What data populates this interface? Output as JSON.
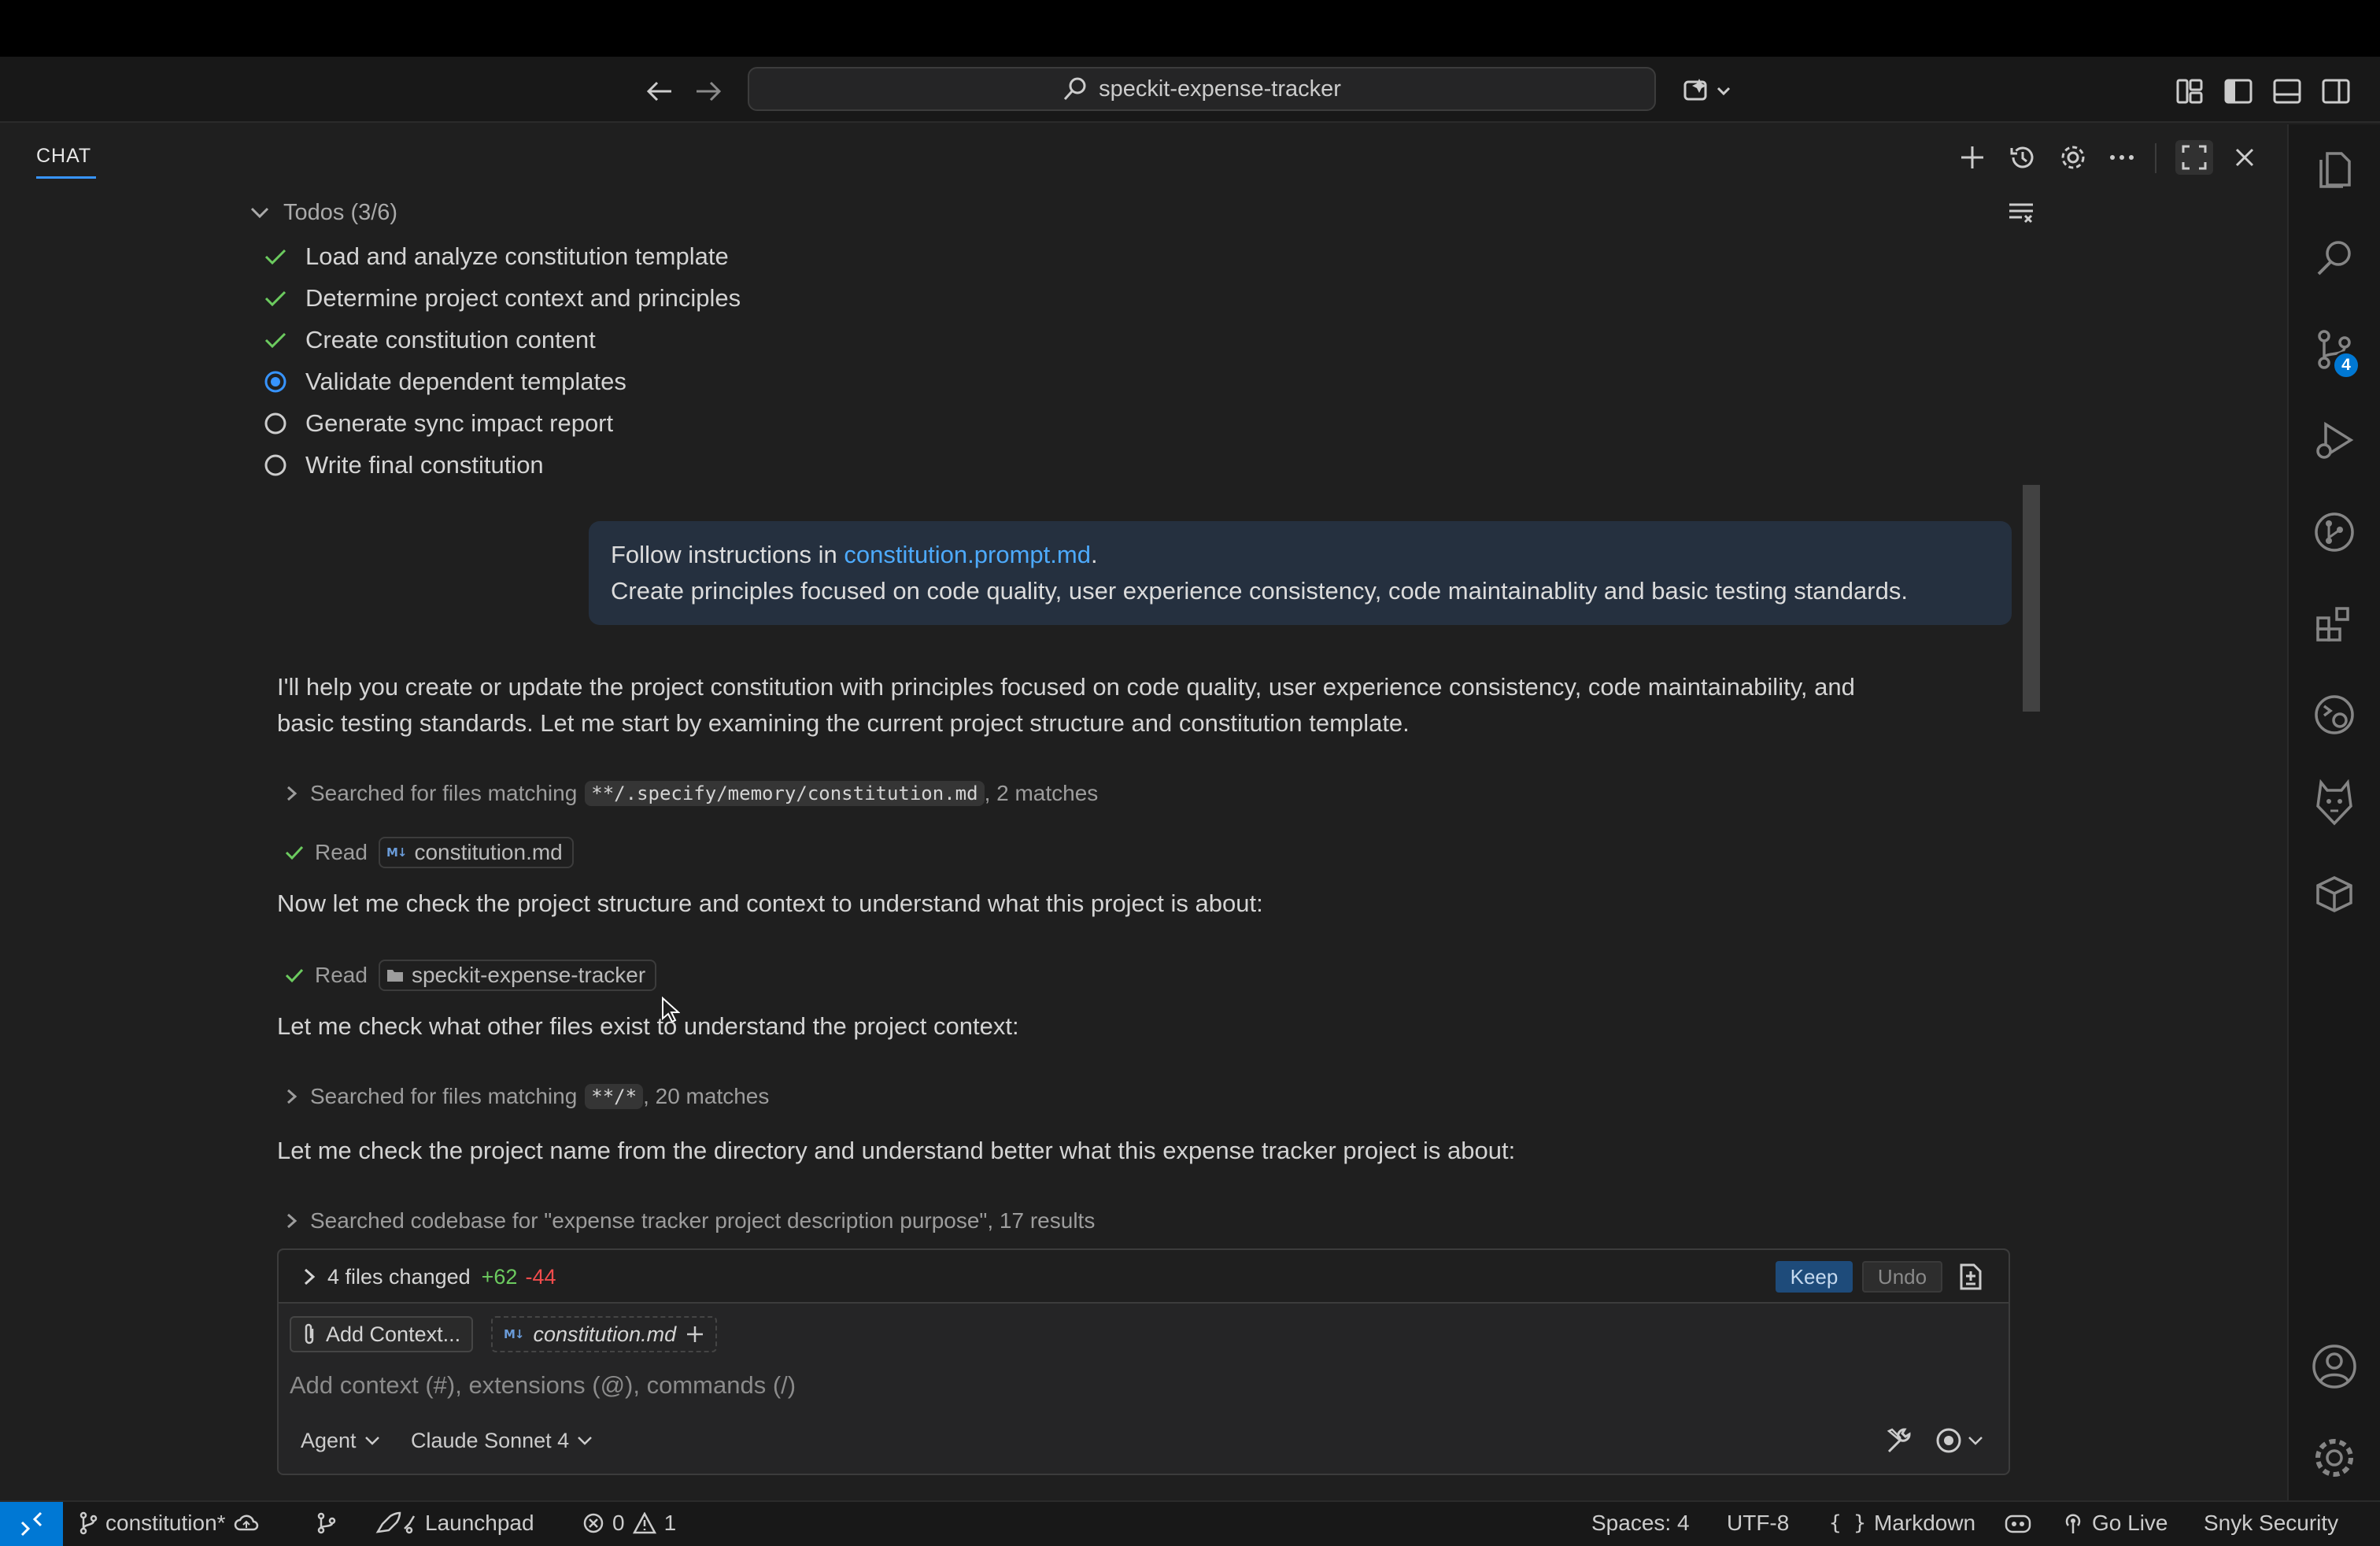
{
  "window": {
    "search_text": "speckit-expense-tracker"
  },
  "chat": {
    "tab_label": "CHAT",
    "todos": {
      "header": "Todos (3/6)",
      "items": [
        {
          "label": "Load and analyze constitution template",
          "status": "done"
        },
        {
          "label": "Determine project context and principles",
          "status": "done"
        },
        {
          "label": "Create constitution content",
          "status": "done"
        },
        {
          "label": "Validate dependent templates",
          "status": "in-progress"
        },
        {
          "label": "Generate sync impact report",
          "status": "pending"
        },
        {
          "label": "Write final constitution",
          "status": "pending"
        }
      ]
    },
    "user_message": {
      "prefix": "Follow instructions in ",
      "link": "constitution.prompt.md",
      "suffix": ".",
      "line2": "Create principles focused on code quality, user experience consistency, code maintainablity and basic testing standards."
    },
    "response": {
      "intro_line1": "I'll help you create or update the project constitution with principles focused on code quality, user experience consistency, code maintainability, and",
      "intro_line2": "basic testing standards. Let me start by examining the current project structure and constitution template.",
      "search1": {
        "prefix": "Searched for files matching",
        "pattern": "**/.specify/memory/constitution.md",
        "suffix": ", 2 matches"
      },
      "read1": {
        "label": "Read",
        "file": "constitution.md"
      },
      "para2": "Now let me check the project structure and context to understand what this project is about:",
      "read2": {
        "label": "Read",
        "folder": "speckit-expense-tracker"
      },
      "para3": "Let me check what other files exist to understand the project context:",
      "search2": {
        "prefix": "Searched for files matching",
        "pattern": "**/*",
        "suffix": ", 20 matches"
      },
      "para4": "Let me check the project name from the directory and understand better what this expense tracker project is about:",
      "search3": "Searched codebase for \"expense tracker project description purpose\", 17 results"
    },
    "changes": {
      "label": "4 files changed",
      "added": "+62",
      "removed": "-44",
      "keep": "Keep",
      "undo": "Undo"
    },
    "input": {
      "add_context": "Add Context...",
      "context_file": "constitution.md",
      "placeholder": "Add context (#), extensions (@), commands (/)",
      "mode": "Agent",
      "model": "Claude Sonnet 4"
    }
  },
  "activity_bar": {
    "scm_badge": "4",
    "icons": [
      "explorer-icon",
      "search-icon",
      "source-control-icon",
      "run-debug-icon",
      "git-graph-icon",
      "extensions-icon",
      "remote-explorer-icon",
      "snyk-icon",
      "box-icon",
      "account-icon",
      "manage-gear-icon"
    ]
  },
  "status_bar": {
    "branch": "constitution*",
    "launchpad": "Launchpad",
    "errors": "0",
    "warnings": "1",
    "spaces": "Spaces: 4",
    "encoding": "UTF-8",
    "language": "Markdown",
    "go_live": "Go Live",
    "snyk": "Snyk Security"
  },
  "colors": {
    "accent": "#0078d4",
    "link": "#4daafc",
    "added": "#6ccb5f",
    "removed": "#f14c4c",
    "bubble": "#25303f"
  }
}
